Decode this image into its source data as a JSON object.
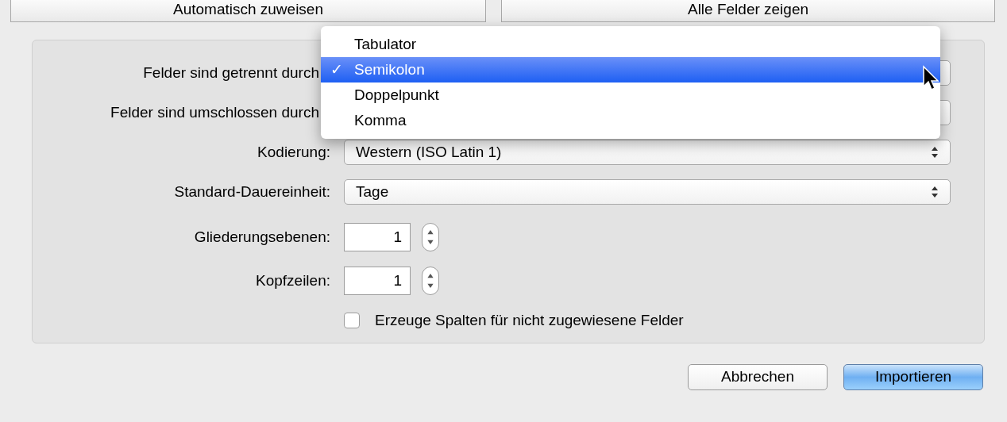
{
  "top_buttons": [
    {
      "label": "Automatisch zuweisen"
    },
    {
      "label": "Alle Felder zeigen"
    }
  ],
  "fields": [
    {
      "kind": "popup",
      "label": "Felder sind getrennt durch"
    },
    {
      "kind": "popup",
      "label": "Felder sind umschlossen durch"
    },
    {
      "kind": "popup",
      "label": "Kodierung:",
      "value": "Western (ISO Latin 1)"
    },
    {
      "kind": "popup",
      "label": "Standard-Dauereinheit:",
      "value": "Tage"
    },
    {
      "kind": "stepper",
      "label": "Gliederungsebenen:",
      "value": "1"
    },
    {
      "kind": "stepper",
      "label": "Kopfzeilen:",
      "value": "1"
    }
  ],
  "checkbox": {
    "label": "Erzeuge Spalten für nicht zugewiesene Felder",
    "checked": false
  },
  "menu": {
    "check": "✓",
    "items": [
      {
        "label": "Tabulator",
        "selected": false
      },
      {
        "label": "Semikolon",
        "selected": true
      },
      {
        "label": "Doppelpunkt",
        "selected": false
      },
      {
        "label": "Komma",
        "selected": false
      }
    ]
  },
  "buttons": [
    {
      "label": "Abbrechen",
      "default": false
    },
    {
      "label": "Importieren",
      "default": true
    }
  ]
}
